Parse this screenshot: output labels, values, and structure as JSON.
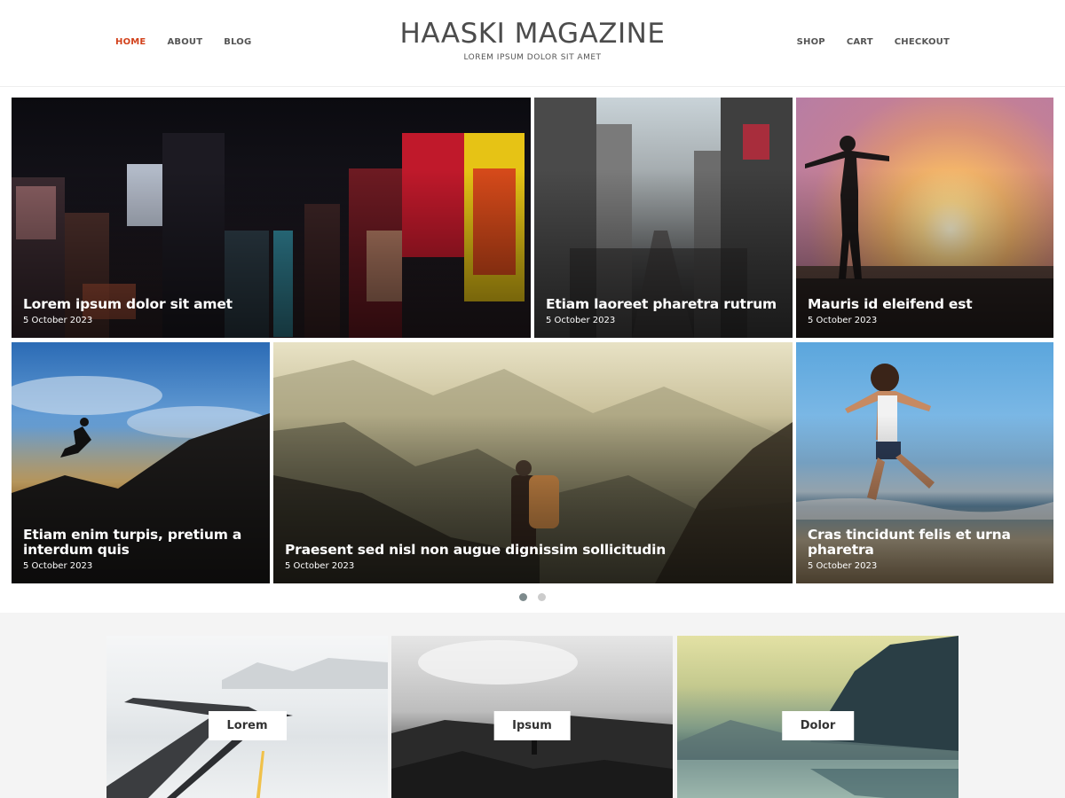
{
  "header": {
    "site_title": "HAASKI MAGAZINE",
    "tagline": "LOREM IPSUM DOLOR SIT AMET",
    "nav_left": [
      "HOME",
      "ABOUT",
      "BLOG"
    ],
    "nav_right": [
      "SHOP",
      "CART",
      "CHECKOUT"
    ],
    "active_nav": "HOME",
    "accent_color": "#d2421c"
  },
  "hero_posts": [
    {
      "title": "Lorem ipsum dolor sit amet",
      "date": "5 October 2023"
    },
    {
      "title": "Etiam laoreet pharetra rutrum",
      "date": "5 October 2023"
    },
    {
      "title": "Mauris id eleifend est",
      "date": "5 October 2023"
    },
    {
      "title": "Etiam enim turpis, pretium a interdum quis",
      "date": "5 October 2023"
    },
    {
      "title": "Praesent sed nisl non augue dignissim sollicitudin",
      "date": "5 October 2023"
    },
    {
      "title": "Cras tincidunt felis et urna pharetra",
      "date": "5 October 2023"
    }
  ],
  "slider": {
    "page_count": 2,
    "active_page": 1
  },
  "categories": [
    {
      "label": "Lorem"
    },
    {
      "label": "Ipsum"
    },
    {
      "label": "Dolor"
    }
  ]
}
